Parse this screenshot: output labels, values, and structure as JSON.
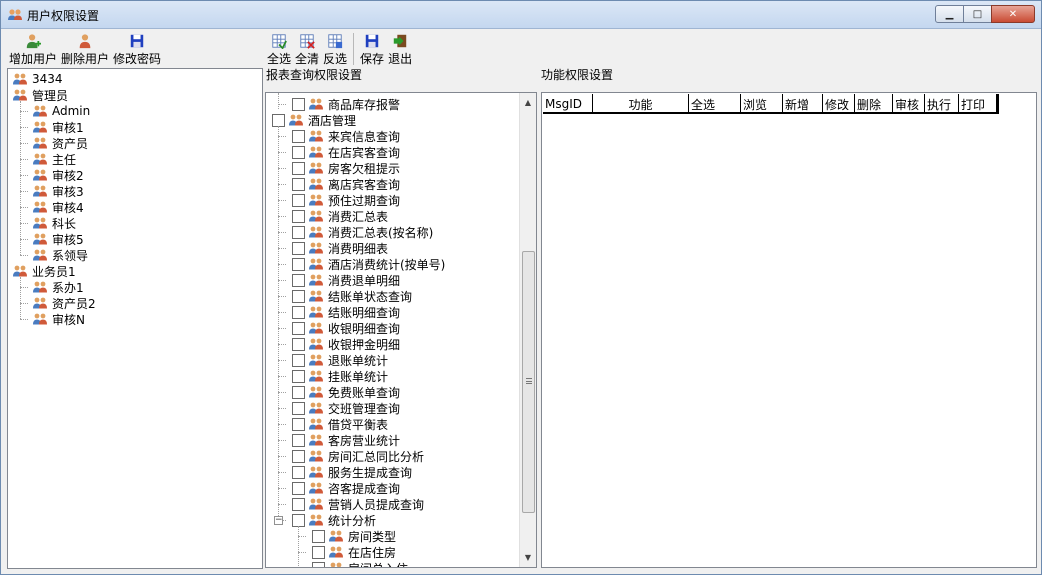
{
  "window": {
    "title": "用户权限设置",
    "minimize": "▁",
    "maximize": "□",
    "close": "✕"
  },
  "toolbar_left": [
    {
      "label": "增加用户",
      "icon": "add-user-icon"
    },
    {
      "label": "删除用户",
      "icon": "delete-user-icon"
    },
    {
      "label": "修改密码",
      "icon": "floppy-icon"
    }
  ],
  "toolbar_right": [
    {
      "label": "全选",
      "icon": "select-all-icon"
    },
    {
      "label": "全清",
      "icon": "clear-all-icon"
    },
    {
      "label": "反选",
      "icon": "invert-select-icon"
    },
    {
      "label": "保存",
      "icon": "save-icon"
    },
    {
      "label": "退出",
      "icon": "exit-icon"
    }
  ],
  "user_tree": [
    {
      "label": "3434",
      "level": 0
    },
    {
      "label": "管理员",
      "level": 0
    },
    {
      "label": "Admin",
      "level": 1
    },
    {
      "label": "审核1",
      "level": 1
    },
    {
      "label": "资产员",
      "level": 1
    },
    {
      "label": "主任",
      "level": 1
    },
    {
      "label": "审核2",
      "level": 1
    },
    {
      "label": "审核3",
      "level": 1
    },
    {
      "label": "审核4",
      "level": 1
    },
    {
      "label": "科长",
      "level": 1
    },
    {
      "label": "审核5",
      "level": 1
    },
    {
      "label": "系领导",
      "level": 1
    },
    {
      "label": "业务员1",
      "level": 0
    },
    {
      "label": "系办1",
      "level": 1
    },
    {
      "label": "资产员2",
      "level": 1
    },
    {
      "label": "审核N",
      "level": 1
    }
  ],
  "report_section_label": "报表查询权限设置",
  "function_section_label": "功能权限设置",
  "report_tree": [
    {
      "label": "商品库存报警",
      "level": 1
    },
    {
      "label": "酒店管理",
      "level": 0
    },
    {
      "label": "来宾信息查询",
      "level": 1
    },
    {
      "label": "在店宾客查询",
      "level": 1
    },
    {
      "label": "房客欠租提示",
      "level": 1
    },
    {
      "label": "离店宾客查询",
      "level": 1
    },
    {
      "label": "预住过期查询",
      "level": 1
    },
    {
      "label": "消费汇总表",
      "level": 1
    },
    {
      "label": "消费汇总表(按名称)",
      "level": 1
    },
    {
      "label": "消费明细表",
      "level": 1
    },
    {
      "label": "酒店消费统计(按单号)",
      "level": 1
    },
    {
      "label": "消费退单明细",
      "level": 1
    },
    {
      "label": "结账单状态查询",
      "level": 1
    },
    {
      "label": "结账明细查询",
      "level": 1
    },
    {
      "label": "收银明细查询",
      "level": 1
    },
    {
      "label": "收银押金明细",
      "level": 1
    },
    {
      "label": "退账单统计",
      "level": 1
    },
    {
      "label": "挂账单统计",
      "level": 1
    },
    {
      "label": "免费账单查询",
      "level": 1
    },
    {
      "label": "交班管理查询",
      "level": 1
    },
    {
      "label": "借贷平衡表",
      "level": 1
    },
    {
      "label": "客房营业统计",
      "level": 1
    },
    {
      "label": "房间汇总同比分析",
      "level": 1
    },
    {
      "label": "服务生提成查询",
      "level": 1
    },
    {
      "label": "咨客提成查询",
      "level": 1
    },
    {
      "label": "营销人员提成查询",
      "level": 1
    },
    {
      "label": "统计分析",
      "level": 1,
      "expander": "−"
    },
    {
      "label": "房间类型",
      "level": 2
    },
    {
      "label": "在店住房",
      "level": 2
    },
    {
      "label": "房间总入住",
      "level": 2
    }
  ],
  "scroll": {
    "up": "▲",
    "down": "▼",
    "grip": "≡"
  },
  "grid_columns": [
    "MsgID",
    "功能",
    "全选",
    "浏览",
    "新增",
    "修改",
    "删除",
    "审核",
    "执行",
    "打印"
  ]
}
